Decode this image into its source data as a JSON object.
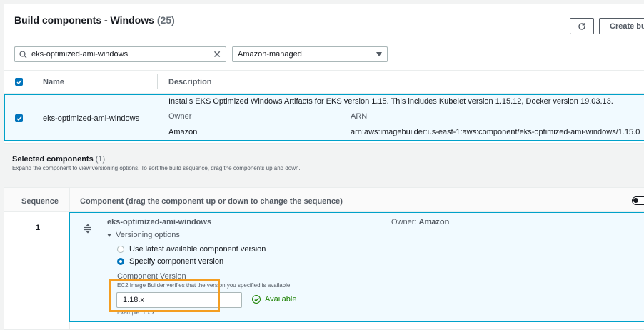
{
  "header": {
    "title": "Build components - Windows",
    "count": "(25)",
    "create_label": "Create bu"
  },
  "filters": {
    "search_value": "eks-optimized-ami-windows",
    "owner_select": "Amazon-managed"
  },
  "table": {
    "col_name": "Name",
    "col_description": "Description",
    "row": {
      "name": "eks-optimized-ami-windows",
      "description": "Installs EKS Optimized Windows Artifacts for EKS version 1.15. This includes Kubelet version 1.15.12, Docker version 19.03.13.",
      "owner_label": "Owner",
      "owner_value": "Amazon",
      "arn_label": "ARN",
      "arn_value": "arn:aws:imagebuilder:us-east-1:aws:component/eks-optimized-ami-windows/1.15.0"
    }
  },
  "selected": {
    "title": "Selected components",
    "count": "(1)",
    "description": "Expand the component to view versioning options. To sort the build sequence, drag the components up and down.",
    "col_sequence": "Sequence",
    "col_component": "Component (drag the component up or down to change the sequence)",
    "item": {
      "sequence": "1",
      "name": "eks-optimized-ami-windows",
      "owner_label": "Owner:",
      "owner_value": "Amazon",
      "versioning_label": "Versioning options",
      "option_latest": "Use latest available component version",
      "option_specify": "Specify component version",
      "version_label": "Component Version",
      "version_hint": "EC2 Image Builder verifies that the version you specified is available.",
      "version_value": "1.18.x",
      "example": "Example: 1.x.x",
      "status": "Available"
    }
  },
  "colors": {
    "accent": "#0073bb",
    "selected_border": "#00a1c9",
    "highlight": "#f49e22",
    "success": "#1d8102"
  }
}
